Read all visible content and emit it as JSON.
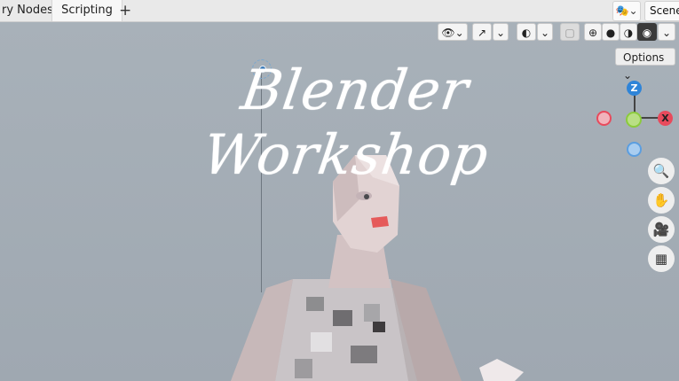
{
  "tabs": {
    "partial_nodes": "ry Nodes",
    "scripting": "Scripting",
    "add": "+"
  },
  "scene": {
    "icon": "🎭",
    "label": "Scene"
  },
  "viewport_header": {
    "options_label": "Options ⌄",
    "buttons": {
      "visibility_icon": "👁",
      "gizmo_icon": "↗",
      "overlay_icon": "◐",
      "xray_icon": "▢",
      "wireframe_icon": "⊕",
      "solid_icon": "●",
      "material_icon": "◑",
      "rendered_icon": "◉",
      "dropdown_arrow": "⌄"
    }
  },
  "title_text": "Blender Workshop",
  "gizmo": {
    "z_label": "Z",
    "x_label": "X",
    "colors": {
      "z": "#2e84d8",
      "x": "#e84a5c",
      "y": "#8bcb3c",
      "neg_x": "#f0a0aa",
      "neg_z": "#9cc3ee"
    }
  },
  "nav": {
    "zoom_icon": "🔍",
    "pan_icon": "✋",
    "camera_icon": "🎥",
    "grid_icon": "▦"
  }
}
